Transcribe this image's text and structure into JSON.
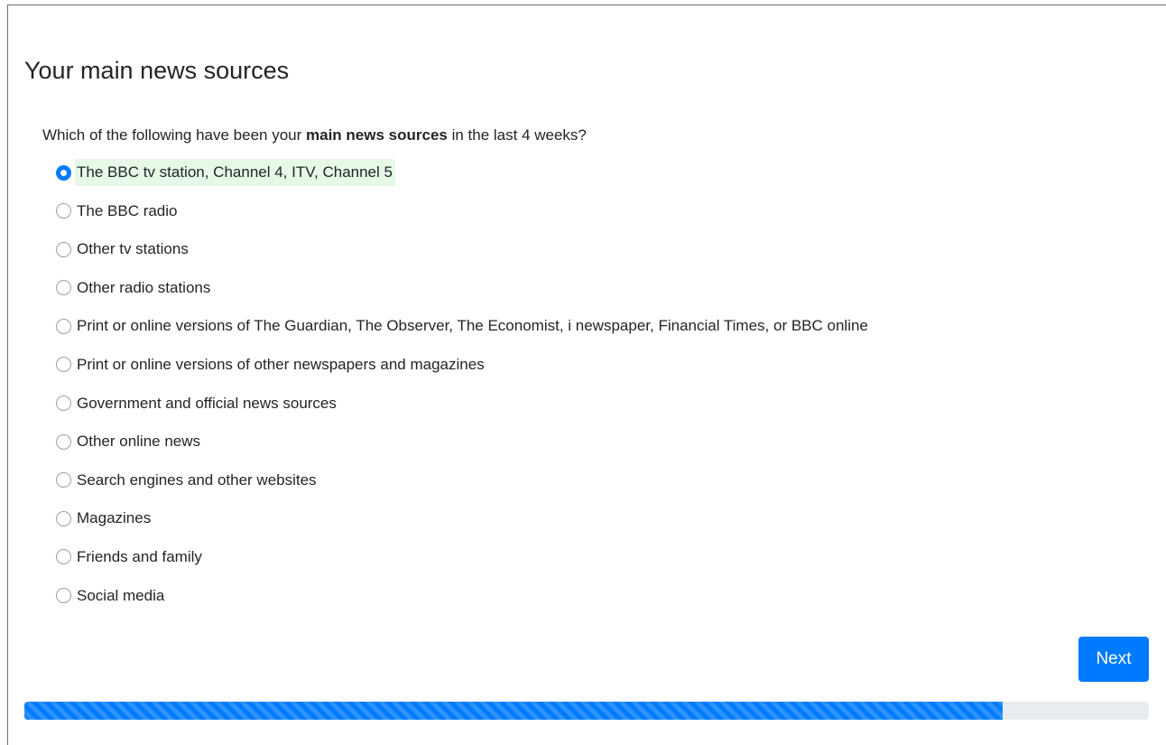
{
  "page": {
    "title": "Your main news sources"
  },
  "question": {
    "prefix": "Which of the following have been your ",
    "bold": "main news sources",
    "suffix": " in the last 4 weeks?"
  },
  "options": [
    {
      "label": "The BBC tv station, Channel 4, ITV, Channel 5",
      "selected": true
    },
    {
      "label": "The BBC radio",
      "selected": false
    },
    {
      "label": "Other tv stations",
      "selected": false
    },
    {
      "label": "Other radio stations",
      "selected": false
    },
    {
      "label": "Print or online versions of The Guardian, The Observer, The Economist, i newspaper, Financial Times, or BBC online",
      "selected": false
    },
    {
      "label": "Print or online versions of other newspapers and magazines",
      "selected": false
    },
    {
      "label": "Government and official news sources",
      "selected": false
    },
    {
      "label": "Other online news",
      "selected": false
    },
    {
      "label": "Search engines and other websites",
      "selected": false
    },
    {
      "label": "Magazines",
      "selected": false
    },
    {
      "label": "Friends and family",
      "selected": false
    },
    {
      "label": "Social media",
      "selected": false
    }
  ],
  "next_button": {
    "label": "Next"
  },
  "progress": {
    "fraction": 0.87
  },
  "colors": {
    "accent": "#007bff",
    "selected_highlight": "#e6f9e6",
    "progress_track": "#e9ecef"
  },
  "icons": {
    "radio_selected": "radio-selected-icon",
    "radio_unselected": "radio-unselected-icon"
  }
}
